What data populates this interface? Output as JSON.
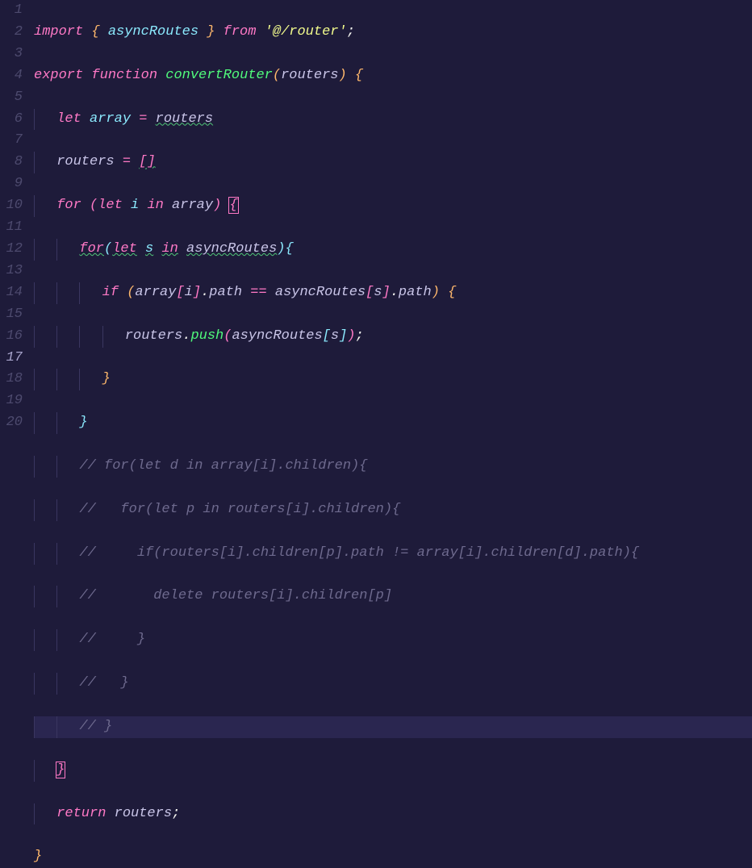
{
  "lines": [
    {
      "num": "1",
      "active": false
    },
    {
      "num": "2",
      "active": false
    },
    {
      "num": "3",
      "active": false
    },
    {
      "num": "4",
      "active": false
    },
    {
      "num": "5",
      "active": false
    },
    {
      "num": "6",
      "active": false
    },
    {
      "num": "7",
      "active": false
    },
    {
      "num": "8",
      "active": false
    },
    {
      "num": "9",
      "active": false
    },
    {
      "num": "10",
      "active": false
    },
    {
      "num": "11",
      "active": false
    },
    {
      "num": "12",
      "active": false
    },
    {
      "num": "13",
      "active": false
    },
    {
      "num": "14",
      "active": false
    },
    {
      "num": "15",
      "active": false
    },
    {
      "num": "16",
      "active": false
    },
    {
      "num": "17",
      "active": true
    },
    {
      "num": "18",
      "active": false
    },
    {
      "num": "19",
      "active": false
    },
    {
      "num": "20",
      "active": false
    }
  ],
  "tok": {
    "import": "import",
    "export": "export",
    "function": "function",
    "let": "let",
    "for": "for",
    "in": "in",
    "if": "if",
    "return": "return",
    "delete": "delete",
    "from": "from",
    "asyncRoutes": "asyncRoutes",
    "routers": "routers",
    "convertRouter": "convertRouter",
    "array": "array",
    "i": "i",
    "s": "s",
    "path": "path",
    "push": "push",
    "routerStr": "'@/router'",
    "eq": "=",
    "eqeq": "==",
    "emptyArr": "[]",
    "semi": ";",
    "comma": ",",
    "dot": ".",
    "lbrace": "{",
    "rbrace": "}",
    "lparen": "(",
    "rparen": ")",
    "lbracket": "[",
    "rbracket": "]"
  },
  "comments": {
    "c1": "// for(let d in array[i].children){",
    "c2": "//   for(let p in routers[i].children){",
    "c3": "//     if(routers[i].children[p].path != array[i].children[d].path){",
    "c4": "//       delete routers[i].children[p]",
    "c5": "//     }",
    "c6": "//   }",
    "c7": "// }"
  }
}
